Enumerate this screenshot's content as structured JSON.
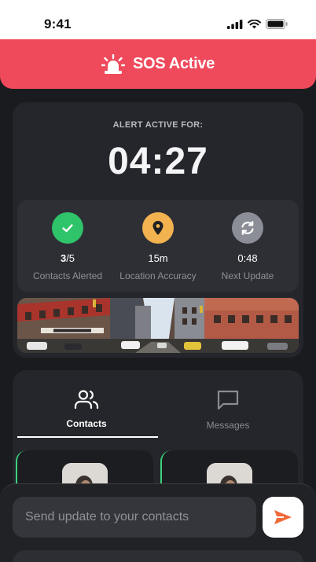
{
  "status_bar": {
    "time": "9:41",
    "icons": [
      "signal-icon",
      "wifi-icon",
      "battery-icon"
    ]
  },
  "header": {
    "title": "SOS Active",
    "icon": "alarm-siren-icon",
    "color": "#ef4a5c"
  },
  "alert": {
    "label": "ALERT ACTIVE FOR:",
    "timer": "04:27"
  },
  "stats": [
    {
      "value_strong": "3",
      "value_rest": "/5",
      "label": "Contacts Alerted",
      "icon": "check-icon",
      "color": "#2fc36a"
    },
    {
      "value_strong": "",
      "value_rest": "15m",
      "label": "Location Accuracy",
      "icon": "location-pin-icon",
      "color": "#f2b24f"
    },
    {
      "value_strong": "",
      "value_rest": "0:48",
      "label": "Next Update",
      "icon": "refresh-icon",
      "color": "#8b8e97"
    }
  ],
  "location_image": {
    "icon": "street-photo"
  },
  "tabs": [
    {
      "label": "Contacts",
      "icon": "contacts-icon",
      "active": true
    },
    {
      "label": "Messages",
      "icon": "message-icon",
      "active": false
    }
  ],
  "contacts": [
    {
      "icon": "avatar",
      "status_color": "#3dd07c"
    },
    {
      "icon": "avatar",
      "status_color": "#3dd07c"
    }
  ],
  "composer": {
    "placeholder": "Send update to your contacts",
    "send_icon": "send-icon",
    "send_color": "#f06a3a"
  }
}
